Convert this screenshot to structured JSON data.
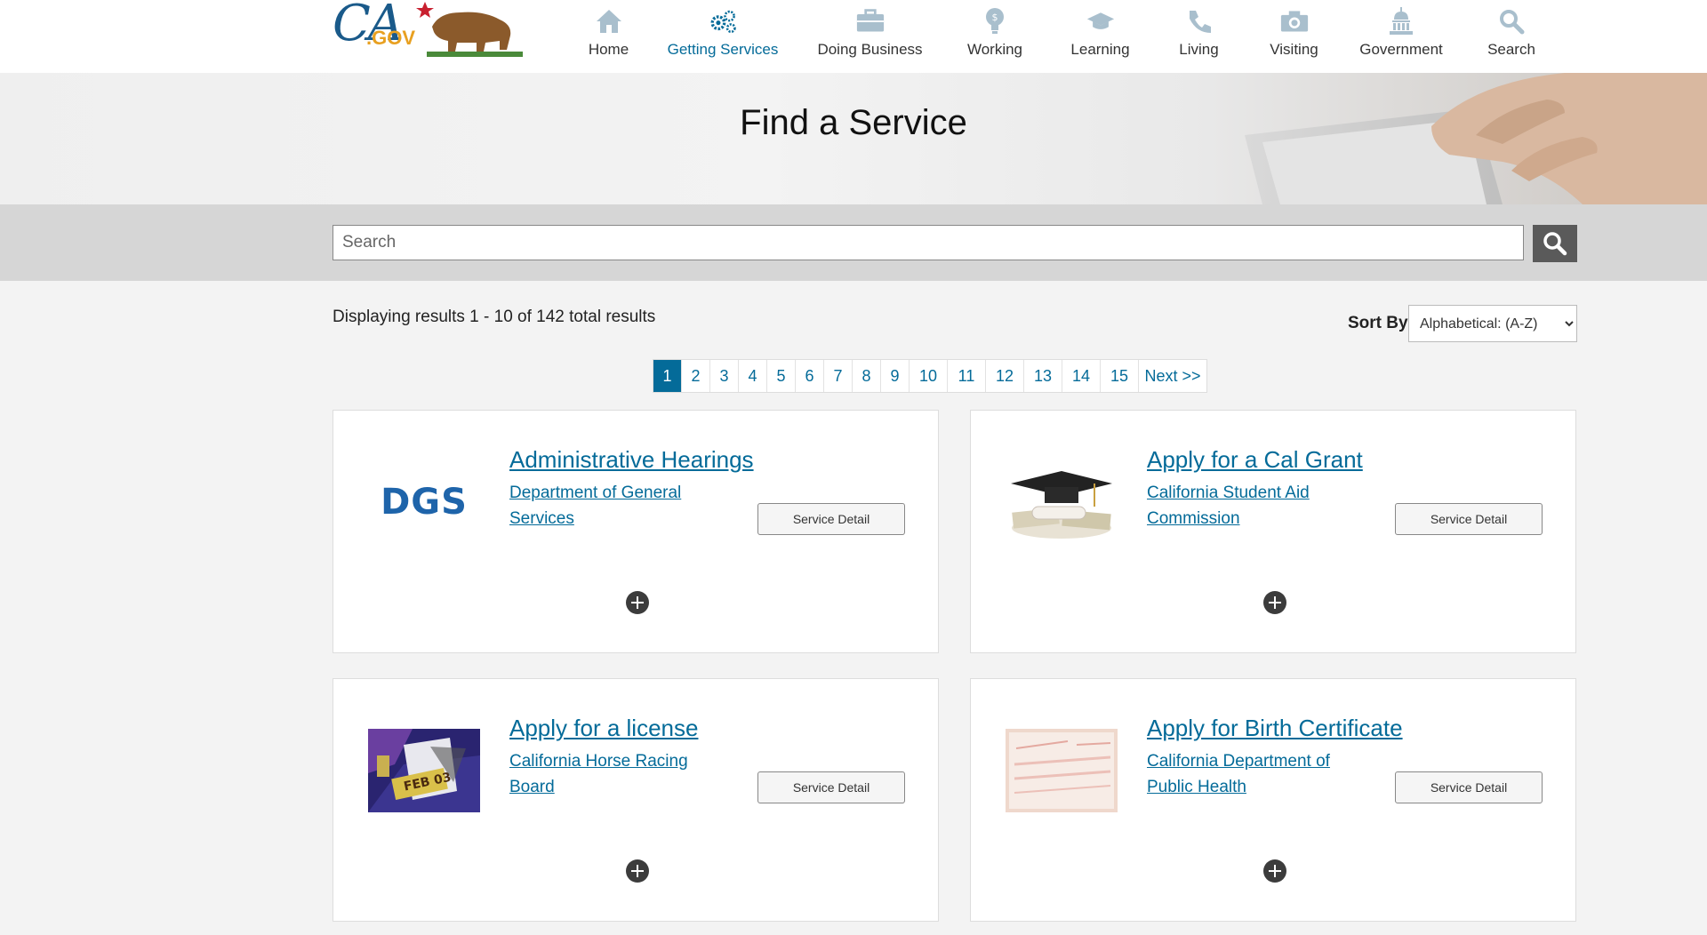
{
  "logo": {
    "ca": "CA",
    "gov": ".GOV"
  },
  "nav": {
    "items": [
      {
        "label": "Home",
        "icon": "home-icon",
        "active": false
      },
      {
        "label": "Getting Services",
        "icon": "gears-icon",
        "active": true
      },
      {
        "label": "Doing Business",
        "icon": "briefcase-icon",
        "active": false
      },
      {
        "label": "Working",
        "icon": "lightbulb-icon",
        "active": false
      },
      {
        "label": "Learning",
        "icon": "graduation-cap-icon",
        "active": false
      },
      {
        "label": "Living",
        "icon": "phone-icon",
        "active": false
      },
      {
        "label": "Visiting",
        "icon": "camera-icon",
        "active": false
      },
      {
        "label": "Government",
        "icon": "capitol-icon",
        "active": false
      },
      {
        "label": "Search",
        "icon": "search-icon",
        "active": false
      }
    ]
  },
  "hero": {
    "title": "Find a Service"
  },
  "search": {
    "placeholder": "Search"
  },
  "results": {
    "summary": "Displaying results 1 - 10 of 142 total results"
  },
  "sort": {
    "label": "Sort By:",
    "selected": "Alphabetical: (A-Z)"
  },
  "pagination": {
    "pages": [
      "1",
      "2",
      "3",
      "4",
      "5",
      "6",
      "7",
      "8",
      "9",
      "10",
      "11",
      "12",
      "13",
      "14",
      "15"
    ],
    "current": "1",
    "next_label": "Next >>"
  },
  "services": [
    {
      "title": "Administrative Hearings",
      "agency": "Department of General Services",
      "detail_label": "Service Detail",
      "thumb": "dgs-logo"
    },
    {
      "title": "Apply for a Cal Grant",
      "agency": "California Student Aid Commission",
      "detail_label": "Service Detail",
      "thumb": "graduation-cap-money-photo"
    },
    {
      "title": "Apply for a license",
      "agency": "California Horse Racing Board",
      "detail_label": "Service Detail",
      "thumb": "license-badge-photo"
    },
    {
      "title": "Apply for Birth Certificate",
      "agency": "California Department of Public Health",
      "detail_label": "Service Detail",
      "thumb": "birth-certificate-photo"
    }
  ],
  "thumbs": {
    "dgs_text": "DGS"
  },
  "colors": {
    "link": "#046b99",
    "active_page": "#046b99",
    "search_button": "#5a5a5a",
    "logo_gold": "#e8a020"
  }
}
